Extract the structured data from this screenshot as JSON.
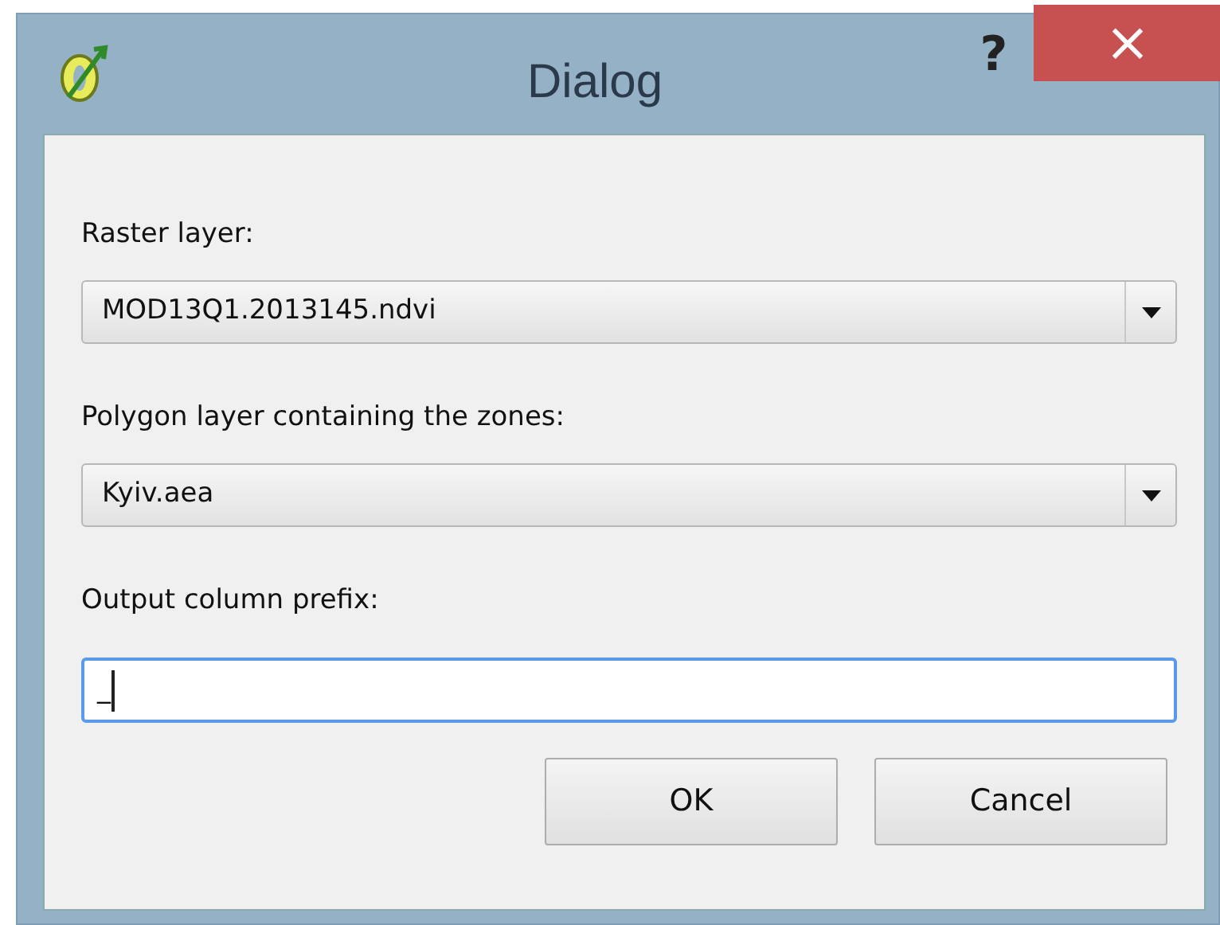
{
  "window": {
    "title": "Dialog",
    "help": "?",
    "close": "×"
  },
  "fields": [
    {
      "kind": "combo",
      "label": "Raster layer:",
      "value": "MOD13Q1.2013145.ndvi"
    },
    {
      "kind": "combo",
      "label": "Polygon layer containing the zones:",
      "value": "Kyiv.aea"
    },
    {
      "kind": "text",
      "label": "Output column prefix:",
      "value": "_",
      "focused": true
    }
  ],
  "buttons": [
    "OK",
    "Cancel"
  ]
}
